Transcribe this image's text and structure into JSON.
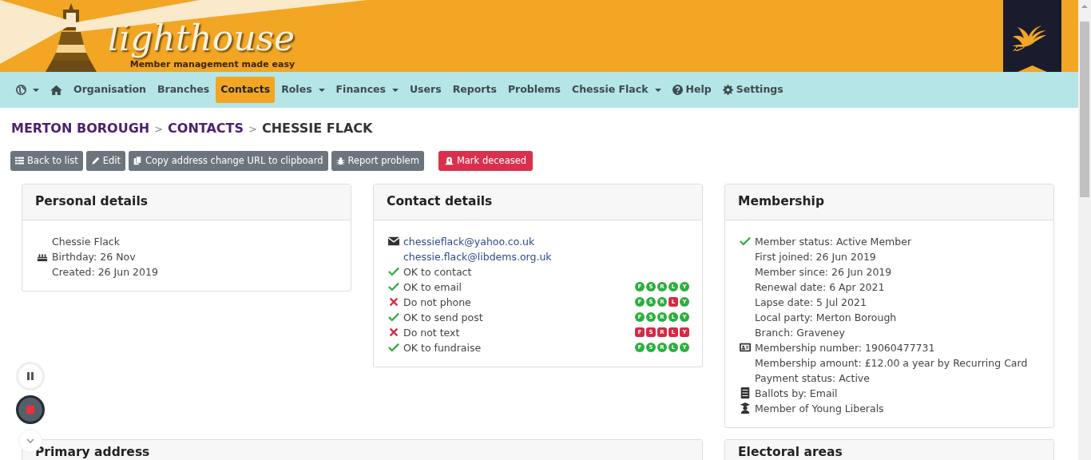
{
  "header": {
    "title": "lighthouse",
    "tagline": "Member management made easy"
  },
  "nav": [
    {
      "kind": "globe",
      "dropdown": true,
      "selected": false
    },
    {
      "kind": "home",
      "dropdown": false,
      "selected": false
    },
    {
      "kind": "text",
      "label": "Organisation",
      "dropdown": false,
      "selected": false
    },
    {
      "kind": "text",
      "label": "Branches",
      "dropdown": false,
      "selected": false
    },
    {
      "kind": "text",
      "label": "Contacts",
      "dropdown": false,
      "selected": true
    },
    {
      "kind": "text",
      "label": "Roles",
      "dropdown": true,
      "selected": false
    },
    {
      "kind": "text",
      "label": "Finances",
      "dropdown": true,
      "selected": false
    },
    {
      "kind": "text",
      "label": "Users",
      "dropdown": false,
      "selected": false
    },
    {
      "kind": "text",
      "label": "Reports",
      "dropdown": false,
      "selected": false
    },
    {
      "kind": "text",
      "label": "Problems",
      "dropdown": false,
      "selected": false
    },
    {
      "kind": "text",
      "label": "Chessie Flack",
      "dropdown": true,
      "selected": false
    },
    {
      "kind": "help",
      "label": "Help",
      "dropdown": false,
      "selected": false
    },
    {
      "kind": "settings",
      "label": "Settings",
      "dropdown": false,
      "selected": false
    }
  ],
  "breadcrumb": [
    {
      "label": "MERTON BOROUGH",
      "link": true
    },
    {
      "label": ">",
      "link": false
    },
    {
      "label": "CONTACTS",
      "link": true
    },
    {
      "label": ">",
      "link": false
    },
    {
      "label": "CHESSIE FLACK",
      "link": false
    }
  ],
  "buttons": [
    {
      "kind": "list",
      "label": "Back to list"
    },
    {
      "kind": "edit",
      "label": "Edit"
    },
    {
      "kind": "copy",
      "label": "Copy address change URL to clipboard"
    },
    {
      "kind": "bug",
      "label": "Report problem"
    },
    {
      "kind": "deceased",
      "label": "Mark deceased"
    }
  ],
  "personal": {
    "title": "Personal details",
    "lines": [
      {
        "kind": "plain",
        "text": "Chessie Flack"
      },
      {
        "kind": "cake",
        "text": "Birthday: 26 Nov"
      },
      {
        "kind": "plain",
        "text": "Created: 26 Jun 2019"
      }
    ]
  },
  "contact": {
    "title": "Contact details",
    "emails": [
      "chessieflack@yahoo.co.uk",
      "chessie.flack@libdems.org.uk"
    ],
    "preferences": [
      {
        "label": "OK to contact",
        "allowed": true
      },
      {
        "label": "OK to email",
        "allowed": true,
        "channels": [
          {
            "letter": "F",
            "on": true
          },
          {
            "letter": "S",
            "on": true
          },
          {
            "letter": "R",
            "on": true
          },
          {
            "letter": "L",
            "on": true
          },
          {
            "letter": "Y",
            "on": true
          }
        ]
      },
      {
        "label": "Do not phone",
        "allowed": false,
        "channels": [
          {
            "letter": "F",
            "on": true
          },
          {
            "letter": "S",
            "on": true
          },
          {
            "letter": "R",
            "on": true
          },
          {
            "letter": "L",
            "on": false
          },
          {
            "letter": "Y",
            "on": true
          }
        ]
      },
      {
        "label": "OK to send post",
        "allowed": true,
        "channels": [
          {
            "letter": "F",
            "on": true
          },
          {
            "letter": "S",
            "on": true
          },
          {
            "letter": "R",
            "on": true
          },
          {
            "letter": "L",
            "on": true
          },
          {
            "letter": "Y",
            "on": true
          }
        ]
      },
      {
        "label": "Do not text",
        "allowed": false,
        "channels": [
          {
            "letter": "F",
            "on": false
          },
          {
            "letter": "S",
            "on": false
          },
          {
            "letter": "R",
            "on": false
          },
          {
            "letter": "L",
            "on": false
          },
          {
            "letter": "Y",
            "on": false
          }
        ]
      },
      {
        "label": "OK to fundraise",
        "allowed": true,
        "channels": [
          {
            "letter": "F",
            "on": true
          },
          {
            "letter": "S",
            "on": true
          },
          {
            "letter": "R",
            "on": true
          },
          {
            "letter": "L",
            "on": true
          },
          {
            "letter": "Y",
            "on": true
          }
        ]
      }
    ]
  },
  "membership": {
    "title": "Membership",
    "lines": [
      {
        "kind": "check",
        "text": "Member status: Active Member"
      },
      {
        "kind": "plain",
        "text": "First joined: 26 Jun 2019"
      },
      {
        "kind": "plain",
        "text": "Member since: 26 Jun 2019"
      },
      {
        "kind": "plain",
        "text": "Renewal date: 6 Apr 2021"
      },
      {
        "kind": "plain",
        "text": "Lapse date: 5 Jul 2021"
      },
      {
        "kind": "plain",
        "text": "Local party: Merton Borough"
      },
      {
        "kind": "plain",
        "text": "Branch: Graveney"
      },
      {
        "kind": "idcard",
        "text": "Membership number: 19060477731"
      },
      {
        "kind": "plain",
        "text": "Membership amount: £12.00 a year by Recurring Card"
      },
      {
        "kind": "plain",
        "text": "Payment status: Active"
      },
      {
        "kind": "ballot",
        "text": "Ballots by: Email"
      },
      {
        "kind": "graduate",
        "text": "Member of Young Liberals"
      }
    ]
  },
  "lower_cards": [
    {
      "title": "Primary address"
    },
    {
      "title": "Electoral areas"
    }
  ]
}
